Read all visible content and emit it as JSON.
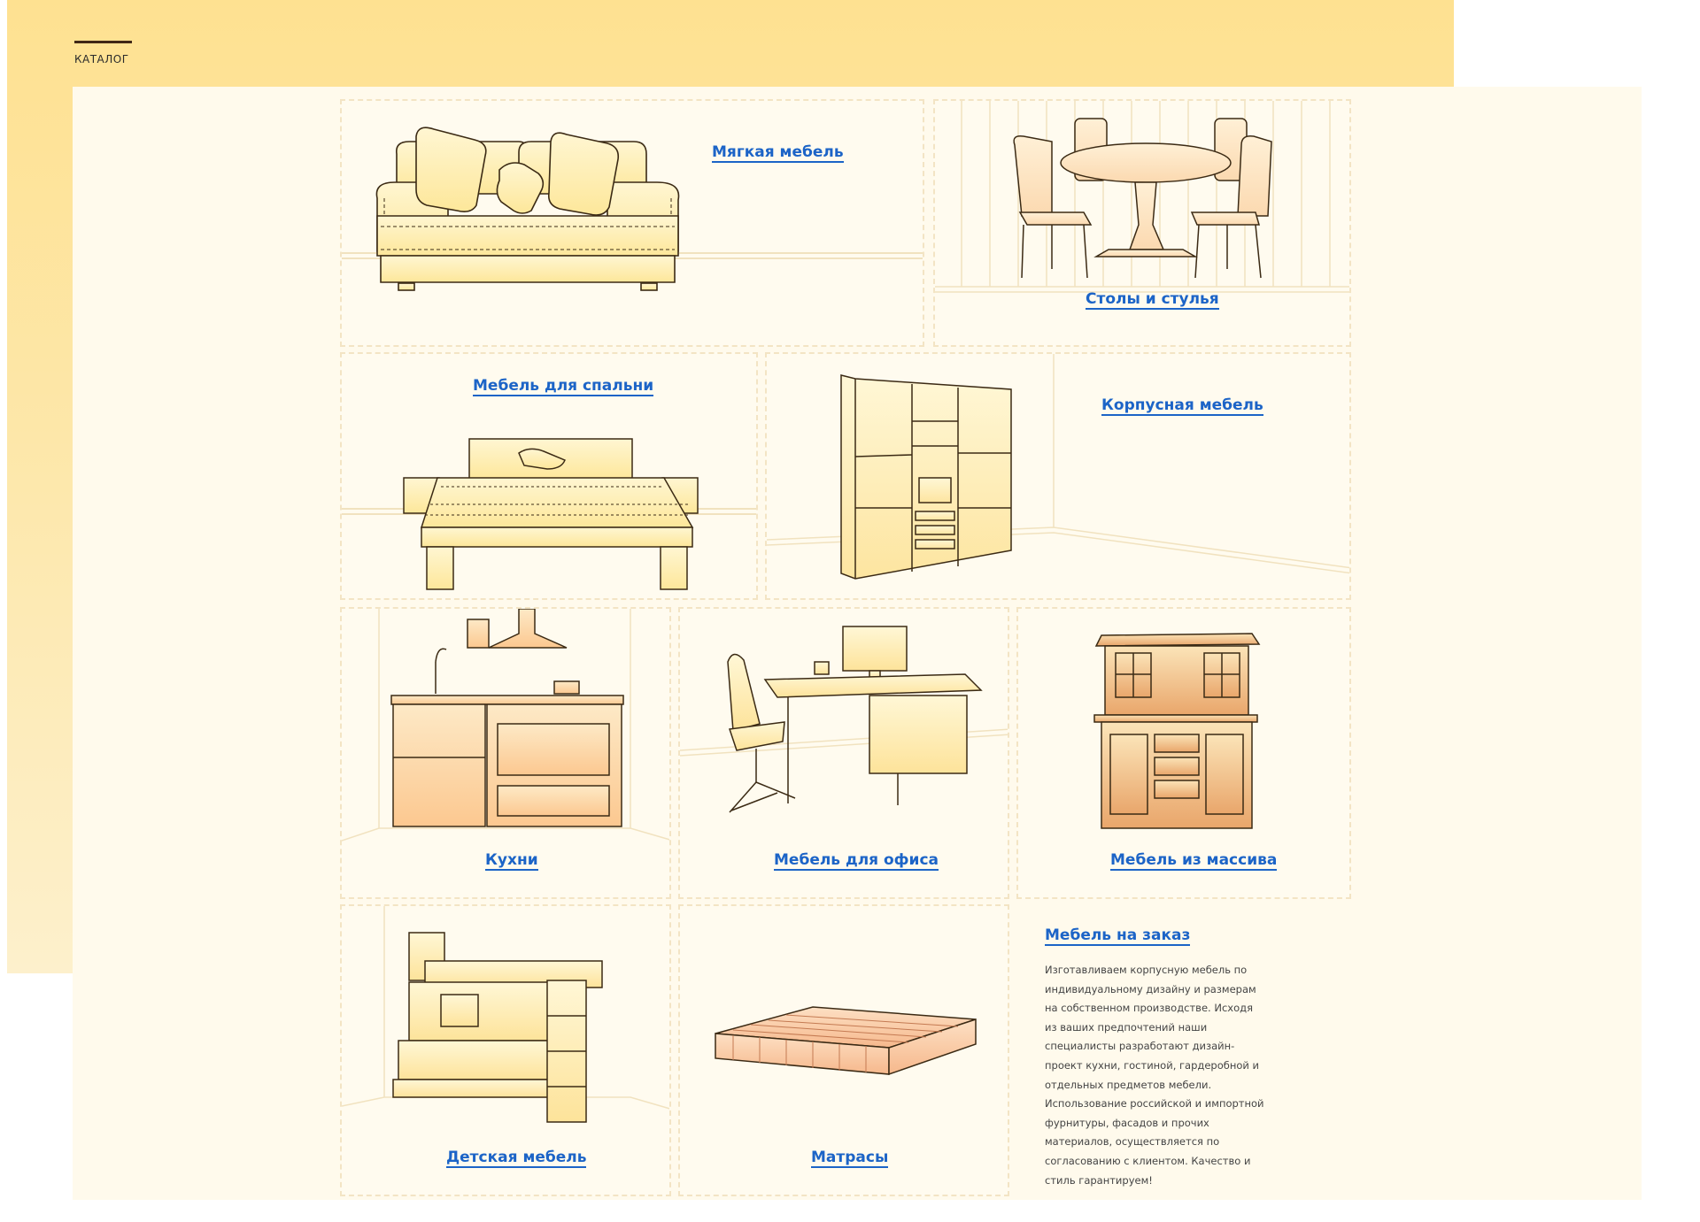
{
  "header": {
    "title": "КАТАЛОГ"
  },
  "catalog": {
    "soft": "Мягкая мебель",
    "dining": "Столы и стулья",
    "bedroom": "Мебель для спальни",
    "cabinet": "Корпусная мебель",
    "kitchen": "Кухни",
    "office": "Мебель для офиса",
    "solid": "Мебель из массива",
    "kids": "Детская мебель",
    "mattress": "Матрасы"
  },
  "custom": {
    "title": "Мебель на заказ",
    "description": "Изготавливаем корпусную мебель по индивидуальному дизайну и размерам на собственном производстве. Исходя из ваших предпочтений наши специалисты разработают дизайн-проект кухни, гостиной, гардеробной и отдельных предметов мебели. Использование российской и импортной фурнитуры, фасадов и прочих материалов, осуществляется по согласованию с клиентом. Качество и стиль гарантируем!"
  },
  "colors": {
    "link": "#1c64c7",
    "header_bg": "#fee191",
    "card_bg": "#fffbef",
    "outline": "#3b2a14"
  }
}
